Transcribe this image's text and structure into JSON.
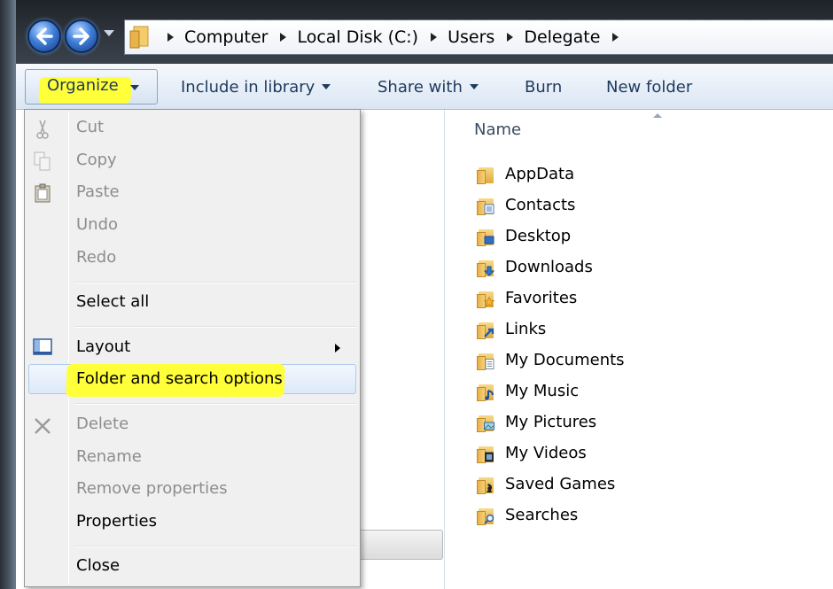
{
  "breadcrumb": {
    "items": [
      "Computer",
      "Local Disk (C:)",
      "Users",
      "Delegate"
    ]
  },
  "toolbar": {
    "organize_label": "Organize",
    "include_label": "Include in library",
    "share_label": "Share with",
    "burn_label": "Burn",
    "newfolder_label": "New folder"
  },
  "file_list": {
    "column_header": "Name",
    "items": [
      {
        "name": "AppData",
        "icon": "folder-icon"
      },
      {
        "name": "Contacts",
        "icon": "contacts-folder-icon"
      },
      {
        "name": "Desktop",
        "icon": "desktop-folder-icon"
      },
      {
        "name": "Downloads",
        "icon": "downloads-folder-icon"
      },
      {
        "name": "Favorites",
        "icon": "favorites-folder-icon"
      },
      {
        "name": "Links",
        "icon": "links-folder-icon"
      },
      {
        "name": "My Documents",
        "icon": "documents-folder-icon"
      },
      {
        "name": "My Music",
        "icon": "music-folder-icon"
      },
      {
        "name": "My Pictures",
        "icon": "pictures-folder-icon"
      },
      {
        "name": "My Videos",
        "icon": "videos-folder-icon"
      },
      {
        "name": "Saved Games",
        "icon": "saved-games-folder-icon"
      },
      {
        "name": "Searches",
        "icon": "searches-folder-icon"
      }
    ]
  },
  "organize_menu": {
    "cut": "Cut",
    "copy": "Copy",
    "paste": "Paste",
    "undo": "Undo",
    "redo": "Redo",
    "select_all": "Select all",
    "layout": "Layout",
    "folder_options": "Folder and search options",
    "delete": "Delete",
    "rename": "Rename",
    "remove_properties": "Remove properties",
    "properties": "Properties",
    "close": "Close"
  },
  "colors": {
    "highlight": "#ffff3a",
    "toolbar_text": "#1e3a5c",
    "disabled_text": "#8d8d8d"
  }
}
